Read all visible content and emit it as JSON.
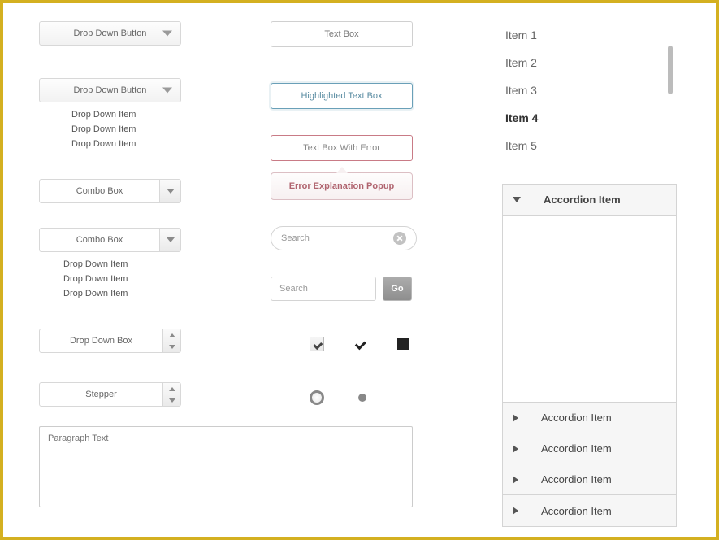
{
  "col1": {
    "dropdown1_label": "Drop Down Button",
    "dropdown2_label": "Drop Down Button",
    "dropdown_items": [
      "Drop Down Item",
      "Drop Down Item",
      "Drop Down Item"
    ],
    "combo1_label": "Combo Box",
    "combo2_label": "Combo Box",
    "combo_items": [
      "Drop Down Item",
      "Drop Down Item",
      "Drop Down Item"
    ],
    "ddbox_label": "Drop Down Box",
    "stepper_label": "Stepper",
    "paragraph_placeholder": "Paragraph Text"
  },
  "col2": {
    "textbox_label": "Text Box",
    "textbox_hl_label": "Highlighted Text Box",
    "textbox_err_label": "Text Box With Error",
    "error_popup_label": "Error Explanation Popup",
    "search_placeholder": "Search",
    "search2_placeholder": "Search",
    "go_label": "Go"
  },
  "col3": {
    "list_items": [
      "Item 1",
      "Item 2",
      "Item 3",
      "Item 4",
      "Item 5"
    ],
    "list_selected_index": 3,
    "accordion": {
      "open_label": "Accordion Item",
      "closed_labels": [
        "Accordion Item",
        "Accordion Item",
        "Accordion Item",
        "Accordion Item"
      ]
    }
  }
}
